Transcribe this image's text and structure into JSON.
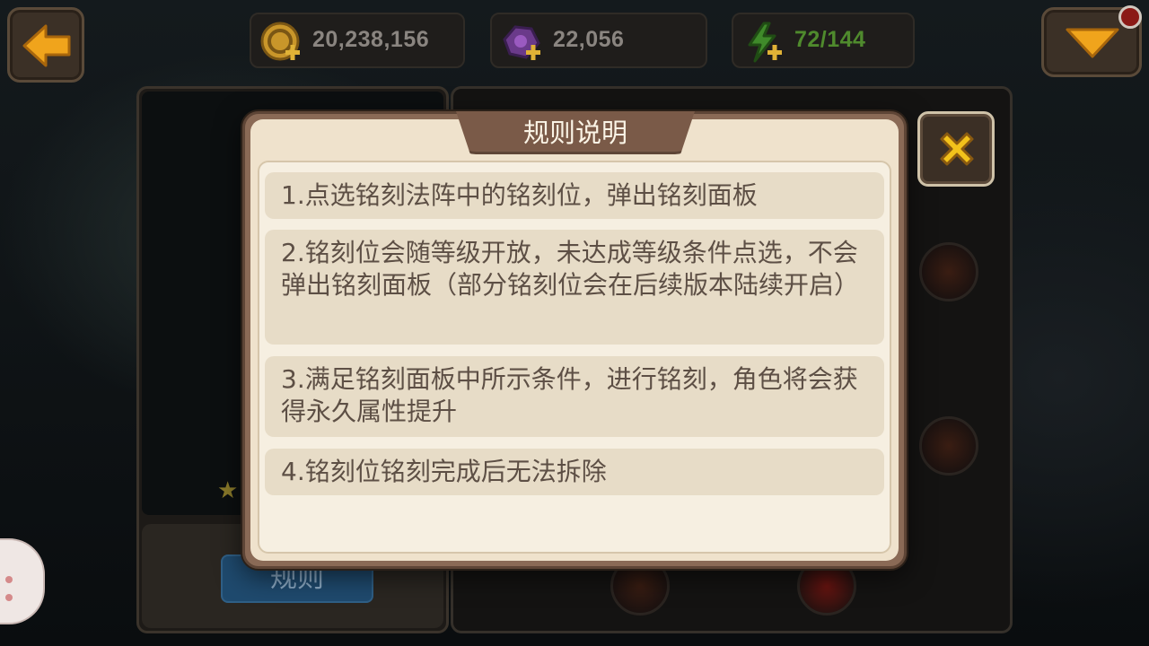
{
  "resources": {
    "gold": "20,238,156",
    "gems": "22,056",
    "energy": "72/144"
  },
  "background": {
    "rule_button_label": "规则"
  },
  "dialog": {
    "title": "规则说明",
    "rules": [
      "1.点选铭刻法阵中的铭刻位，弹出铭刻面板",
      "2.铭刻位会随等级开放，未达成等级条件点选，不会弹出铭刻面板（部分铭刻位会在后续版本陆续开启）",
      "3.满足铭刻面板中所示条件，进行铭刻，角色将会获得永久属性提升",
      "4.铭刻位铭刻完成后无法拆除"
    ]
  },
  "icons": {
    "back": "arrow-left-icon",
    "gold": "gold-coin-plus-icon",
    "gem": "gem-plus-icon",
    "energy": "lightning-plus-icon",
    "menu": "chevron-down-icon",
    "close": "close-icon"
  },
  "colors": {
    "gold_arrow": "#f0a41c",
    "energy_text": "#4f8a2d",
    "close_x": "#f2c21b",
    "notification": "#8b1a16"
  }
}
